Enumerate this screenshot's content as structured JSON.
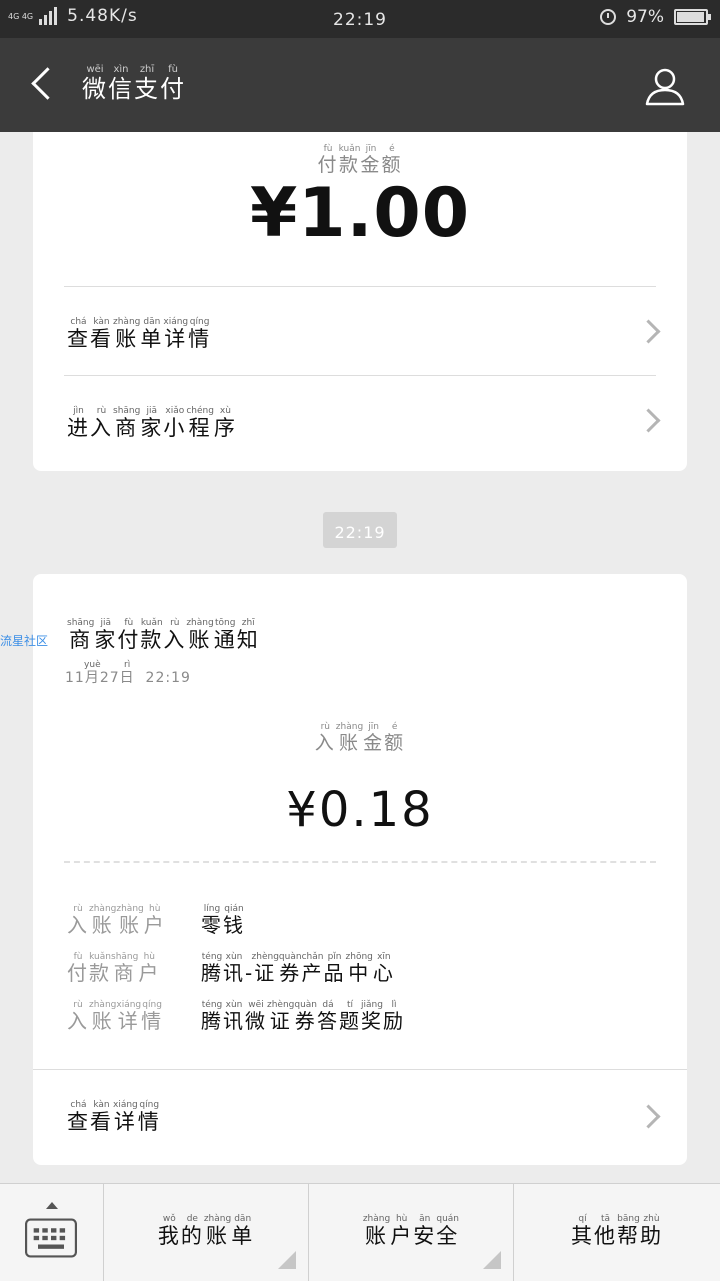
{
  "status_bar": {
    "network": "4G 4G",
    "speed": "5.48K/s",
    "time": "22:19",
    "battery": "97%",
    "battery_level": 0.97
  },
  "nav": {
    "title": [
      {
        "char": "微",
        "pinyin": "wēi"
      },
      {
        "char": "信",
        "pinyin": "xìn"
      },
      {
        "char": "支",
        "pinyin": "zhī"
      },
      {
        "char": "付",
        "pinyin": "fù"
      }
    ]
  },
  "payment_card": {
    "label": [
      {
        "char": "付",
        "pinyin": "fù"
      },
      {
        "char": "款",
        "pinyin": "kuǎn"
      },
      {
        "char": "金",
        "pinyin": "jīn"
      },
      {
        "char": "额",
        "pinyin": "é"
      }
    ],
    "amount": "¥1.00",
    "rows": [
      {
        "text": [
          {
            "char": "查",
            "pinyin": "chá"
          },
          {
            "char": "看",
            "pinyin": "kàn"
          },
          {
            "char": "账",
            "pinyin": "zhàng"
          },
          {
            "char": "单",
            "pinyin": "dān"
          },
          {
            "char": "详",
            "pinyin": "xiáng"
          },
          {
            "char": "情",
            "pinyin": "qíng"
          }
        ]
      },
      {
        "text": [
          {
            "char": "进",
            "pinyin": "jìn"
          },
          {
            "char": "入",
            "pinyin": "rù"
          },
          {
            "char": "商",
            "pinyin": "shāng"
          },
          {
            "char": "家",
            "pinyin": "jiā"
          },
          {
            "char": "小",
            "pinyin": "xiǎo"
          },
          {
            "char": "程",
            "pinyin": "chéng"
          },
          {
            "char": "序",
            "pinyin": "xù"
          }
        ]
      }
    ]
  },
  "timestamp": "22:19",
  "watermark": "流星社区",
  "notice_card": {
    "title": [
      {
        "char": "商",
        "pinyin": "shāng"
      },
      {
        "char": "家",
        "pinyin": "jiā"
      },
      {
        "char": "付",
        "pinyin": "fù"
      },
      {
        "char": "款",
        "pinyin": "kuǎn"
      },
      {
        "char": "入",
        "pinyin": "rù"
      },
      {
        "char": "账",
        "pinyin": "zhàng"
      },
      {
        "char": "通",
        "pinyin": "tōng"
      },
      {
        "char": "知",
        "pinyin": "zhī"
      }
    ],
    "date": [
      {
        "char": "11",
        "pinyin": ""
      },
      {
        "char": "月",
        "pinyin": "yuè"
      },
      {
        "char": "27",
        "pinyin": ""
      },
      {
        "char": "日",
        "pinyin": "rì"
      },
      {
        "char": "  22:19",
        "pinyin": ""
      }
    ],
    "amount_label": [
      {
        "char": "入",
        "pinyin": "rù"
      },
      {
        "char": "账",
        "pinyin": "zhàng"
      },
      {
        "char": "金",
        "pinyin": "jīn"
      },
      {
        "char": "额",
        "pinyin": "é"
      }
    ],
    "amount": "¥0.18",
    "details": [
      {
        "key": [
          {
            "char": "入",
            "pinyin": "rù"
          },
          {
            "char": "账",
            "pinyin": "zhàng"
          },
          {
            "char": "账",
            "pinyin": "zhàng"
          },
          {
            "char": "户",
            "pinyin": "hù"
          }
        ],
        "value": [
          {
            "char": "零",
            "pinyin": "líng"
          },
          {
            "char": "钱",
            "pinyin": "qián"
          }
        ]
      },
      {
        "key": [
          {
            "char": "付",
            "pinyin": "fù"
          },
          {
            "char": "款",
            "pinyin": "kuǎn"
          },
          {
            "char": "商",
            "pinyin": "shāng"
          },
          {
            "char": "户",
            "pinyin": "hù"
          }
        ],
        "value": [
          {
            "char": "腾",
            "pinyin": "téng"
          },
          {
            "char": "讯",
            "pinyin": "xùn"
          },
          {
            "char": "-",
            "pinyin": ""
          },
          {
            "char": "证",
            "pinyin": "zhèng"
          },
          {
            "char": "券",
            "pinyin": "quàn"
          },
          {
            "char": "产",
            "pinyin": "chǎn"
          },
          {
            "char": "品",
            "pinyin": "pǐn"
          },
          {
            "char": "中",
            "pinyin": "zhōng"
          },
          {
            "char": "心",
            "pinyin": "xīn"
          }
        ]
      },
      {
        "key": [
          {
            "char": "入",
            "pinyin": "rù"
          },
          {
            "char": "账",
            "pinyin": "zhàng"
          },
          {
            "char": "详",
            "pinyin": "xiáng"
          },
          {
            "char": "情",
            "pinyin": "qíng"
          }
        ],
        "value": [
          {
            "char": "腾",
            "pinyin": "téng"
          },
          {
            "char": "讯",
            "pinyin": "xùn"
          },
          {
            "char": "微",
            "pinyin": "wēi"
          },
          {
            "char": "证",
            "pinyin": "zhèng"
          },
          {
            "char": "券",
            "pinyin": "quàn"
          },
          {
            "char": "答",
            "pinyin": "dá"
          },
          {
            "char": "题",
            "pinyin": "tí"
          },
          {
            "char": "奖",
            "pinyin": "jiǎng"
          },
          {
            "char": "励",
            "pinyin": "lì"
          }
        ]
      }
    ],
    "details_link": [
      {
        "char": "查",
        "pinyin": "chá"
      },
      {
        "char": "看",
        "pinyin": "kàn"
      },
      {
        "char": "详",
        "pinyin": "xiáng"
      },
      {
        "char": "情",
        "pinyin": "qíng"
      }
    ]
  },
  "bottom_menu": [
    [
      {
        "char": "我",
        "pinyin": "wǒ"
      },
      {
        "char": "的",
        "pinyin": "de"
      },
      {
        "char": "账",
        "pinyin": "zhàng"
      },
      {
        "char": "单",
        "pinyin": "dān"
      }
    ],
    [
      {
        "char": "账",
        "pinyin": "zhàng"
      },
      {
        "char": "户",
        "pinyin": "hù"
      },
      {
        "char": "安",
        "pinyin": "ān"
      },
      {
        "char": "全",
        "pinyin": "quán"
      }
    ],
    [
      {
        "char": "其",
        "pinyin": "qí"
      },
      {
        "char": "他",
        "pinyin": "tā"
      },
      {
        "char": "帮",
        "pinyin": "bāng"
      },
      {
        "char": "助",
        "pinyin": "zhù"
      }
    ]
  ],
  "colors": {
    "status_bar": "#2b2b2b",
    "nav_bar": "#3b3b3b",
    "background": "#ececec",
    "watermark": "#3d8fe6"
  },
  "icons": {
    "back": "chevron-left-icon",
    "profile": "user-icon",
    "keyboard": "keyboard-icon",
    "row_arrow": "chevron-right-icon"
  }
}
